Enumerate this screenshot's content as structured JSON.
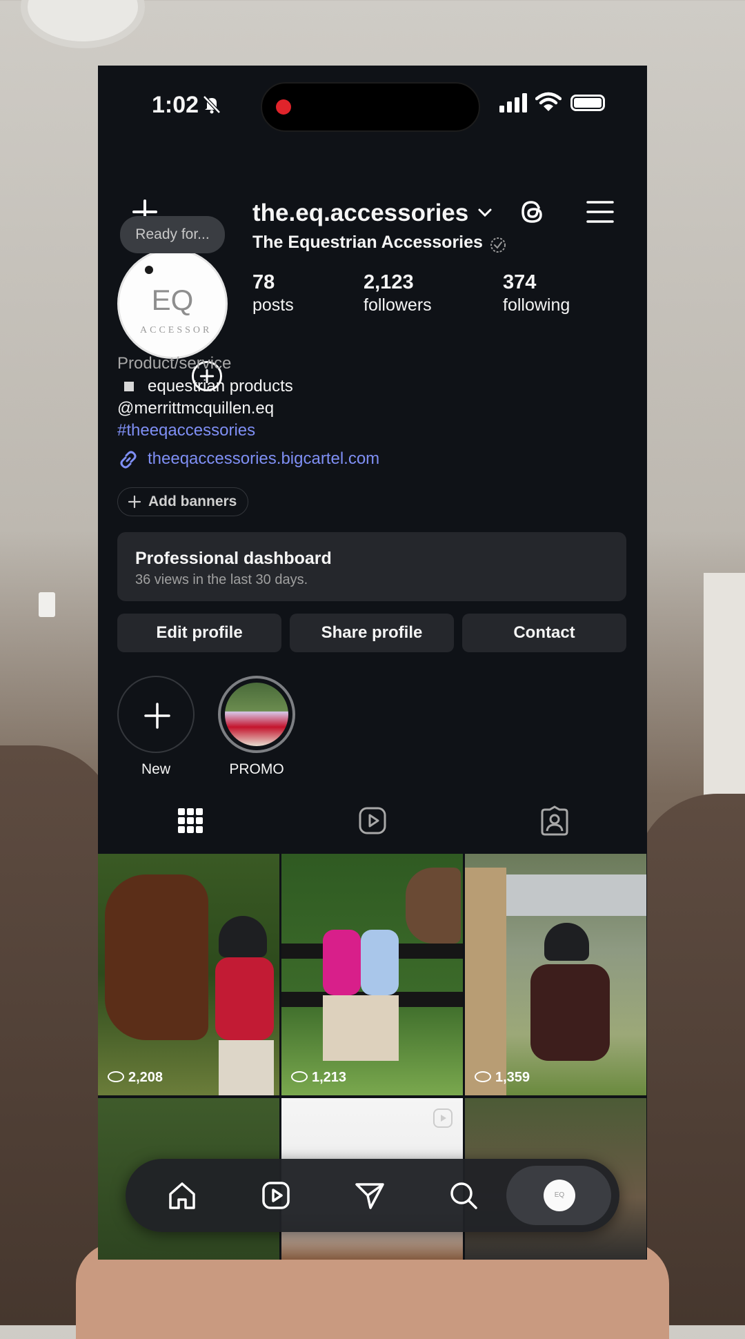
{
  "status_bar": {
    "time": "1:02"
  },
  "header": {
    "username": "the.eq.accessories"
  },
  "profile": {
    "bubble": "Ready for...",
    "avatar_text": "EQ",
    "avatar_arc_text": "ACCESSOR",
    "display_name": "The Equestrian Accessories",
    "stats": [
      {
        "num": "78",
        "label": "posts"
      },
      {
        "num": "2,123",
        "label": "followers"
      },
      {
        "num": "374",
        "label": "following"
      }
    ],
    "category": "Product/service",
    "bio_line": "equestrian products",
    "mention": "@merrittmcquillen.eq",
    "hashtag": "#theeqaccessories",
    "link": "theeqaccessories.bigcartel.com"
  },
  "add_banners": "Add banners",
  "dashboard": {
    "title": "Professional dashboard",
    "subtitle": "36 views in the last 30 days."
  },
  "buttons": {
    "edit": "Edit profile",
    "share": "Share profile",
    "contact": "Contact"
  },
  "highlights": [
    {
      "label": "New"
    },
    {
      "label": "PROMO"
    }
  ],
  "posts": [
    {
      "views": "2,208"
    },
    {
      "views": "1,213"
    },
    {
      "views": "1,359"
    }
  ],
  "nav": {
    "avatar_text": "EQ"
  },
  "colors": {
    "link": "#7f8ff4",
    "background": "#0f1217",
    "card": "#25272c",
    "record": "#e0242b"
  }
}
